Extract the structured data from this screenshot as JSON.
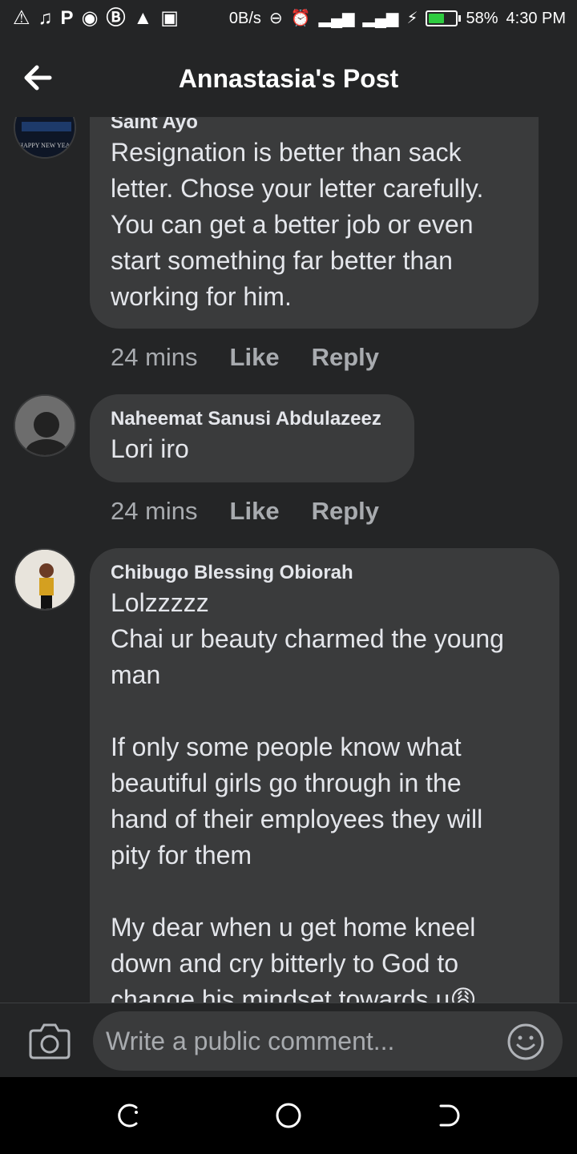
{
  "status_bar": {
    "left_icons": [
      "warning-icon",
      "music-icon",
      "p-icon",
      "circle-icon",
      "b-icon",
      "alert-icon",
      "image-icon"
    ],
    "net_speed": "0B/s",
    "battery_percent": "58%",
    "battery_level": 0.58,
    "time": "4:30 PM"
  },
  "header": {
    "title": "Annastasia's Post"
  },
  "comments": [
    {
      "author": "Saint Ayo",
      "text": "Resignation is better than sack\nletter. Chose your letter carefully.\nYou can get a better job or even\nstart something far better than\nworking for him.",
      "time": "24 mins",
      "like": "Like",
      "reply": "Reply"
    },
    {
      "author": "Naheemat Sanusi Abdulazeez",
      "text": "Lori iro",
      "time": "24 mins",
      "like": "Like",
      "reply": "Reply"
    },
    {
      "author": "Chibugo Blessing Obiorah",
      "text": "Lolzzzzz\nChai ur beauty charmed the young\nman\n\nIf only some people know what\nbeautiful girls go through in the\nhand of their employees they will\npity for them\n\nMy dear when u get home kneel\ndown and cry bitterly to God to\nchange his mindset towards u😩"
    }
  ],
  "composer": {
    "placeholder": "Write a public comment..."
  },
  "colors": {
    "background": "#242526",
    "bubble": "#3a3b3c",
    "text": "#e4e6eb",
    "muted": "#a8abaf"
  }
}
